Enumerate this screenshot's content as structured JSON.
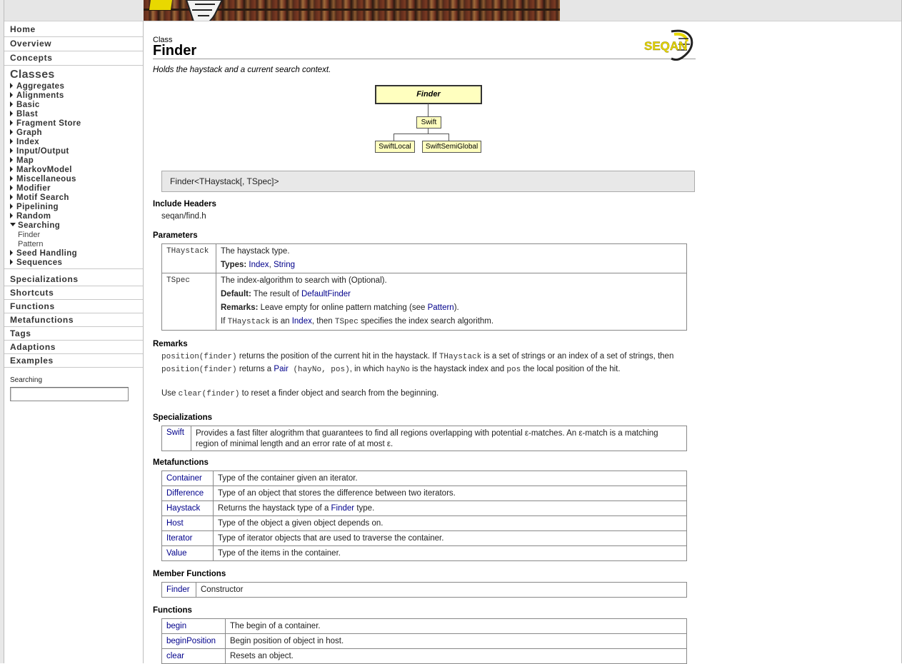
{
  "sidebar": {
    "top_links": [
      "Home",
      "Overview",
      "Concepts"
    ],
    "classes_heading": "Classes",
    "categories": [
      {
        "label": "Aggregates"
      },
      {
        "label": "Alignments"
      },
      {
        "label": "Basic"
      },
      {
        "label": "Blast"
      },
      {
        "label": "Fragment Store"
      },
      {
        "label": "Graph"
      },
      {
        "label": "Index"
      },
      {
        "label": "Input/Output"
      },
      {
        "label": "Map"
      },
      {
        "label": "MarkovModel"
      },
      {
        "label": "Miscellaneous"
      },
      {
        "label": "Modifier"
      },
      {
        "label": "Motif Search"
      },
      {
        "label": "Pipelining"
      },
      {
        "label": "Random"
      },
      {
        "label": "Searching",
        "expanded": true,
        "children": [
          "Finder",
          "Pattern"
        ]
      },
      {
        "label": "Seed Handling"
      },
      {
        "label": "Sequences"
      }
    ],
    "sections": [
      "Specializations",
      "Shortcuts",
      "Functions",
      "Metafunctions",
      "Tags",
      "Adaptions",
      "Examples"
    ],
    "search_label": "Searching",
    "search_value": ""
  },
  "header": {
    "kind": "Class",
    "title": "Finder",
    "logo_text": "SEQAN",
    "summary": "Holds the haystack and a current search context."
  },
  "diagram": {
    "root": "Finder",
    "child": "Swift",
    "leaves": [
      "SwiftLocal",
      "SwiftSemiGlobal"
    ]
  },
  "signature": "Finder<THaystack[, TSpec]>",
  "include": {
    "heading": "Include Headers",
    "value": "seqan/find.h"
  },
  "parameters": {
    "heading": "Parameters",
    "rows": [
      {
        "name": "THaystack",
        "desc": "The haystack type.",
        "types_label": "Types:",
        "types": [
          "Index",
          "String"
        ]
      },
      {
        "name": "TSpec",
        "desc": "The index-algorithm to search with (Optional).",
        "default_label": "Default:",
        "default_text": "The result of",
        "default_link": "DefaultFinder",
        "remarks_label": "Remarks:",
        "remarks_text": "Leave empty for online pattern matching (see",
        "remarks_link": "Pattern",
        "remarks_end": ").",
        "if_text_1": "If",
        "if_code_1": "THaystack",
        "if_text_2": "is an",
        "if_link": "Index",
        "if_text_3": ", then",
        "if_code_2": "TSpec",
        "if_text_4": "specifies the index search algorithm."
      }
    ]
  },
  "remarks": {
    "heading": "Remarks",
    "p1": {
      "c1": "position(finder)",
      "t1": " returns the position of the current hit in the haystack. If ",
      "c2": "THaystack",
      "t2": " is a set of strings or an index of a set of strings, then ",
      "c3": "position(finder)",
      "t3": " returns a ",
      "link": "Pair",
      "c4": " (hayNo, pos)",
      "t4": ", in which ",
      "c5": "hayNo",
      "t5": " is the haystack index and ",
      "c6": "pos",
      "t6": " the local position of the hit."
    },
    "p2": {
      "t1": "Use ",
      "c1": "clear(finder)",
      "t2": " to reset a finder object and search from the beginning."
    }
  },
  "specializations": {
    "heading": "Specializations",
    "rows": [
      {
        "name": "Swift",
        "desc": "Provides a fast filter alogrithm that guarantees to find all regions overlapping with potential ε-matches. An ε-match is a matching region of minimal length and an error rate of at most ε."
      }
    ]
  },
  "metafunctions": {
    "heading": "Metafunctions",
    "rows": [
      {
        "name": "Container",
        "desc": "Type of the container given an iterator."
      },
      {
        "name": "Difference",
        "desc": "Type of an object that stores the difference between two iterators."
      },
      {
        "name": "Haystack",
        "desc_pre": "Returns the haystack type of a ",
        "desc_link": "Finder",
        "desc_post": " type."
      },
      {
        "name": "Host",
        "desc": "Type of the object a given object depends on."
      },
      {
        "name": "Iterator",
        "desc": "Type of iterator objects that are used to traverse the container."
      },
      {
        "name": "Value",
        "desc": "Type of the items in the container."
      }
    ]
  },
  "member_functions": {
    "heading": "Member Functions",
    "rows": [
      {
        "name": "Finder",
        "desc": "Constructor"
      }
    ]
  },
  "functions": {
    "heading": "Functions",
    "rows": [
      {
        "name": "begin",
        "desc": "The begin of a container."
      },
      {
        "name": "beginPosition",
        "desc": "Begin position of object in host."
      },
      {
        "name": "clear",
        "desc": "Resets an object."
      }
    ]
  }
}
